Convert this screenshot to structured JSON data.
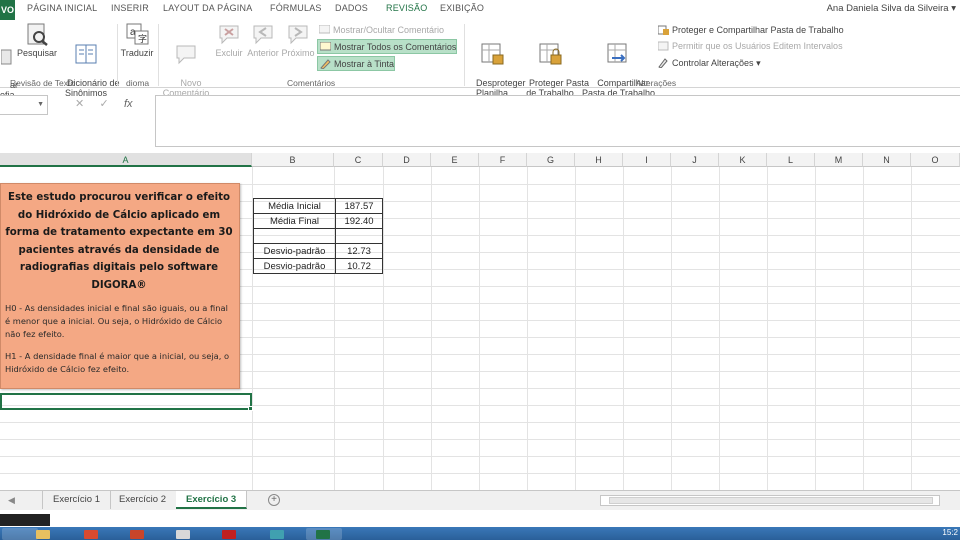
{
  "ribbon": {
    "file_label": "VO",
    "tabs": [
      "PÁGINA INICIAL",
      "INSERIR",
      "LAYOUT DA PÁGINA",
      "FÓRMULAS",
      "DADOS",
      "REVISÃO",
      "EXIBIÇÃO"
    ],
    "active_tab": "REVISÃO",
    "user": "Ana Daniela Silva da Silveira",
    "proofing": {
      "buttons": [
        "ar\nefia",
        "Pesquisar",
        "Dicionário de\nSinônimos"
      ],
      "label": "Revisão de Texto"
    },
    "language": {
      "button": "Traduzir",
      "label": "dioma"
    },
    "comments": {
      "new": "Novo\nComentário",
      "delete": "Excluir",
      "previous": "Anterior",
      "next": "Próximo",
      "show_hide": "Mostrar/Ocultar Comentário",
      "show_all": "Mostrar Todos os Comentários",
      "show_ink": "Mostrar à Tinta",
      "label": "Comentários"
    },
    "changes": {
      "unprotect_sheet": "Desproteger\nPlanilha",
      "protect_workbook": "Proteger Pasta\nde Trabalho",
      "share_workbook": "Compartilhar\nPasta de Trabalho",
      "protect_share": "Proteger e Compartilhar Pasta de Trabalho",
      "allow_edit": "Permitir que os Usuários Editem Intervalos",
      "track_changes": "Controlar Alterações",
      "label": "Alterações"
    },
    "accent": "#217346"
  },
  "formula_bar": {
    "name_box": "",
    "cancel": "✕",
    "enter": "✓",
    "fx": "fx",
    "content": ""
  },
  "grid": {
    "columns": [
      "A",
      "B",
      "C",
      "D",
      "E",
      "F",
      "G",
      "H",
      "I",
      "J",
      "K",
      "L",
      "M",
      "N",
      "O"
    ],
    "selected_column": "A",
    "comment": {
      "title": "Este estudo procurou verificar o efeito do Hidróxido de Cálcio aplicado em forma de tratamento expectante em 30 pacientes através da densidade de radiografias digitais pelo software DIGORA®",
      "h0": "H0 - As densidades inicial e final são iguais, ou a final é menor que a inicial. Ou seja, o Hidróxido de Cálcio não fez efeito.",
      "h1": "H1 - A densidade final é maior que a inicial, ou seja, o Hidróxido de Cálcio fez efeito.",
      "color": "#f4a884"
    },
    "stats": [
      {
        "label": "Média Inicial",
        "value": "187.57"
      },
      {
        "label": "Média Final",
        "value": "192.40"
      },
      {
        "label": "",
        "value": ""
      },
      {
        "label": "Desvio-padrão",
        "value": "12.73"
      },
      {
        "label": "Desvio-padrão",
        "value": "10.72"
      }
    ]
  },
  "sheets": {
    "nav": "◀",
    "tabs": [
      "Exercício 1",
      "Exercício 2",
      "Exercício 3"
    ],
    "active": "Exercício 3",
    "add": "+"
  },
  "taskbar": {
    "clock": "15:2"
  }
}
